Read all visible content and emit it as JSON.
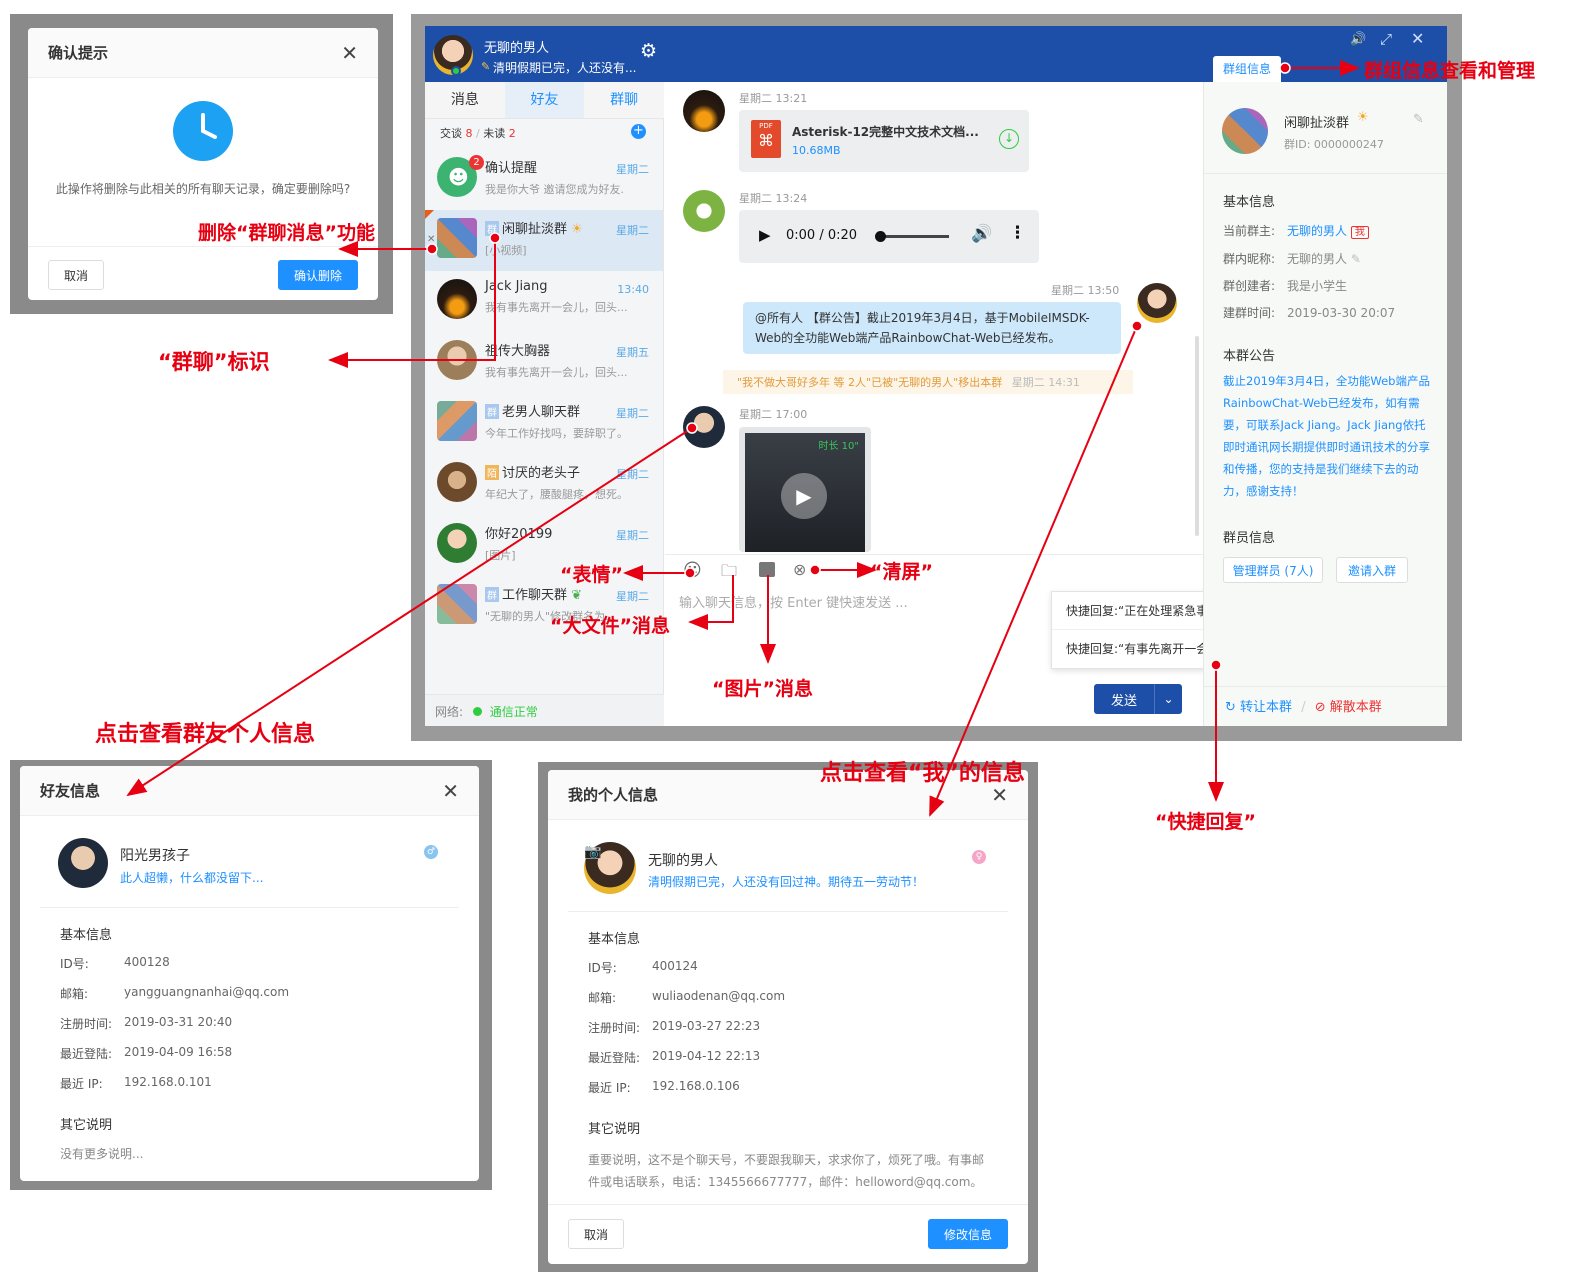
{
  "confirm_dialog": {
    "title": "确认提示",
    "message": "此操作将删除与此相关的所有聊天记录，确定要删除吗?",
    "cancel": "取消",
    "confirm": "确认删除"
  },
  "chat_window": {
    "header": {
      "user_name": "无聊的男人",
      "signature": "清明假期已完，人还没有..."
    },
    "tabs": [
      "消息",
      "好友",
      "群聊"
    ],
    "counts": {
      "talk_label": "交谈",
      "talk_count": "8",
      "sep": "/",
      "unread_label": "未读",
      "unread_count": "2"
    },
    "conversations": [
      {
        "name": "确认提醒",
        "time": "星期二",
        "preview": "我是你大爷 邀请您成为好友.",
        "badge": "2",
        "group": false
      },
      {
        "name": "闲聊扯淡群",
        "time": "星期二",
        "preview": "[小视频]",
        "group": true,
        "tag": "群"
      },
      {
        "name": "Jack Jiang",
        "time": "13:40",
        "preview": "我有事先离开一会儿，回头...",
        "group": false
      },
      {
        "name": "祖传大胸器",
        "time": "星期五",
        "preview": "我有事先离开一会儿，回头...",
        "group": false
      },
      {
        "name": "老男人聊天群",
        "time": "星期二",
        "preview": "今年工作好找吗，要辞职了。",
        "group": true,
        "tag": "群"
      },
      {
        "name": "讨厌的老头子",
        "time": "星期二",
        "preview": "年纪大了，腰酸腿疼，想死。",
        "group": false,
        "tag": "陌"
      },
      {
        "name": "你好20199",
        "time": "星期二",
        "preview": "[图片]",
        "group": false
      },
      {
        "name": "工作聊天群",
        "time": "星期二",
        "preview": "\"无聊的男人\"修改群名为...",
        "group": true,
        "tag": "群"
      }
    ],
    "status": {
      "label": "网络:",
      "value": "通信正常"
    },
    "messages": {
      "m1_time": "星期二 13:21",
      "file_name": "Asterisk-12完整中文技术文档...",
      "file_size": "10.68MB",
      "pdf_label": "PDF",
      "m2_time": "星期二 13:24",
      "audio_time": "0:00 / 0:20",
      "m3_time": "星期二 13:50",
      "m3_text": "@所有人 【群公告】截止2019年3月4日，基于MobileIMSDK-Web的全功能Web端产品RainbowChat-Web已经发布。",
      "system_notice": "\"我不做大哥好多年 等 2人\"已被\"无聊的男人\"移出本群",
      "system_time": "星期二 14:31",
      "m4_time": "星期二 17:00",
      "video_caption": "时长 10\""
    },
    "input": {
      "placeholder": "输入聊天信息，按 Enter 键快速发送 ...",
      "send": "发送"
    },
    "quick_replies": [
      "快捷回复:“正在处理紧急事情”",
      "快捷回复:“有事先离开一会儿”"
    ],
    "group_panel": {
      "tab": "群组信息",
      "group_name": "闲聊扯淡群",
      "group_id": "群ID: 0000000247",
      "basic_title": "基本信息",
      "owner_k": "当前群主:",
      "owner_v": "无聊的男人",
      "owner_tag": "我",
      "nick_k": "群内昵称:",
      "nick_v": "无聊的男人",
      "creator_k": "群创建者:",
      "creator_v": "我是小学生",
      "created_k": "建群时间:",
      "created_v": "2019-03-30 20:07",
      "notice_title": "本群公告",
      "notice": "截止2019年3月4日，全功能Web端产品RainbowChat-Web已经发布，如有需要，可联系Jack Jiang。Jack Jiang依托即时通讯网长期提供即时通讯技术的分享和传播，您的支持是我们继续下去的动力，感谢支持！",
      "members_title": "群员信息",
      "manage_btn": "管理群员 (7人)",
      "invite_btn": "邀请入群",
      "transfer": "转让本群",
      "dismiss": "解散本群",
      "sep": "/"
    }
  },
  "friend_dialog": {
    "title": "好友信息",
    "name": "阳光男孩子",
    "signature": "此人超懒，什么都没留下...",
    "basic_title": "基本信息",
    "rows": [
      {
        "k": "ID号:",
        "v": "400128"
      },
      {
        "k": "邮箱:",
        "v": "yangguangnanhai@qq.com"
      },
      {
        "k": "注册时间:",
        "v": "2019-03-31 20:40"
      },
      {
        "k": "最近登陆:",
        "v": "2019-04-09 16:58"
      },
      {
        "k": "最近 IP:",
        "v": "192.168.0.101"
      }
    ],
    "other_title": "其它说明",
    "other_text": "没有更多说明..."
  },
  "my_dialog": {
    "title": "我的个人信息",
    "name": "无聊的男人",
    "signature": "清明假期已完，人还没有回过神。期待五一劳动节！",
    "basic_title": "基本信息",
    "rows": [
      {
        "k": "ID号:",
        "v": "400124"
      },
      {
        "k": "邮箱:",
        "v": "wuliaodenan@qq.com"
      },
      {
        "k": "注册时间:",
        "v": "2019-03-27 22:23"
      },
      {
        "k": "最近登陆:",
        "v": "2019-04-12 22:13"
      },
      {
        "k": "最近 IP:",
        "v": "192.168.0.106"
      }
    ],
    "other_title": "其它说明",
    "other_text": "重要说明，这不是个聊天号，不要跟我聊天，求求你了，烦死了哦。有事邮件或电话联系，电话：1345566677777，邮件：helloword@qq.com。",
    "cancel": "取消",
    "edit": "修改信息"
  },
  "annotations": {
    "delete": "删除“群聊消息”功能",
    "group_mark": "“群聊”标识",
    "emoji": "“表情”",
    "clear": "“清屏”",
    "bigfile": "“大文件”消息",
    "image": "“图片”消息",
    "friend_info": "点击查看群友个人信息",
    "my_info": "点击查看“我”的信息",
    "quick_reply": "“快捷回复”",
    "group_manage": "群组信息查看和管理"
  },
  "colors": {
    "header_blue": "#1d4fa8",
    "accent": "#1e90ff",
    "annotation": "#e60012",
    "green": "#2ecc40"
  }
}
